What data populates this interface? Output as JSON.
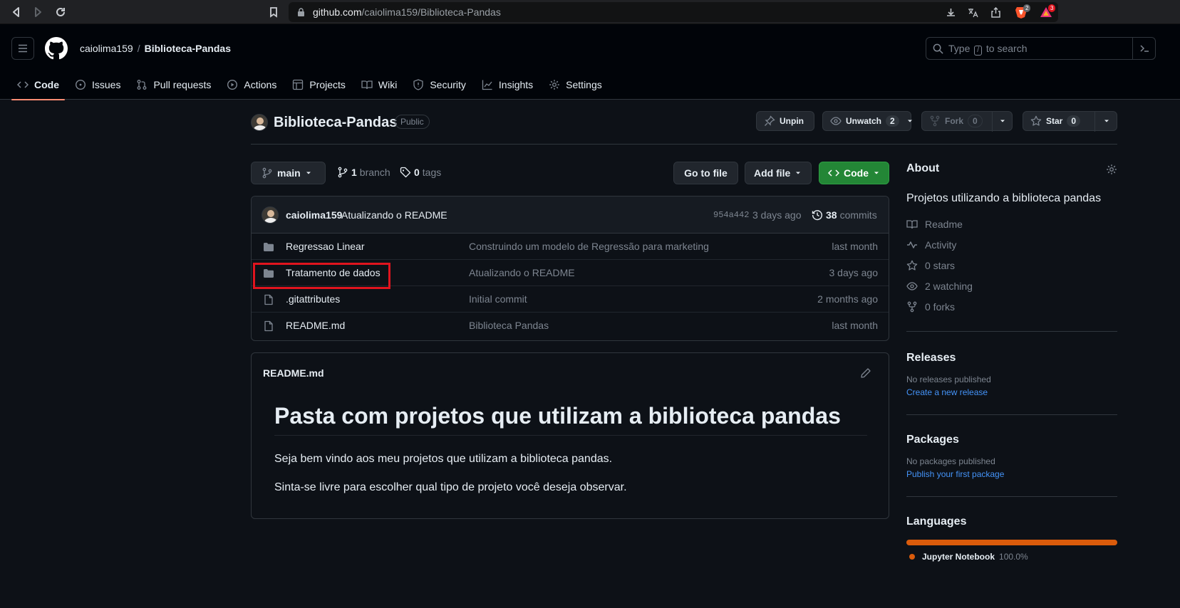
{
  "browser": {
    "url_host": "github.com",
    "url_path": "/caiolima159/Biblioteca-Pandas",
    "brave_badge": "2",
    "ext_badge": "3"
  },
  "header": {
    "owner": "caiolima159",
    "separator": "/",
    "repo": "Biblioteca-Pandas",
    "search_prefix": "Type",
    "search_key": "/",
    "search_suffix": "to search"
  },
  "tabs": [
    {
      "label": "Code",
      "icon": "code-icon"
    },
    {
      "label": "Issues",
      "icon": "issue-icon"
    },
    {
      "label": "Pull requests",
      "icon": "pull-request-icon"
    },
    {
      "label": "Actions",
      "icon": "play-icon"
    },
    {
      "label": "Projects",
      "icon": "table-icon"
    },
    {
      "label": "Wiki",
      "icon": "book-icon"
    },
    {
      "label": "Security",
      "icon": "shield-icon"
    },
    {
      "label": "Insights",
      "icon": "graph-icon"
    },
    {
      "label": "Settings",
      "icon": "gear-icon"
    }
  ],
  "repo": {
    "title": "Biblioteca-Pandas",
    "visibility": "Public",
    "unpin": "Unpin",
    "watch": "Unwatch",
    "watch_count": "2",
    "fork": "Fork",
    "fork_count": "0",
    "star": "Star",
    "star_count": "0"
  },
  "branchbar": {
    "branch": "main",
    "branch_count": "1",
    "branch_label": "branch",
    "tag_count": "0",
    "tag_label": "tags",
    "goto": "Go to file",
    "addfile": "Add file",
    "code": "Code"
  },
  "commit": {
    "author": "caiolima159",
    "message": "Atualizando o README",
    "sha": "954a442",
    "time": "3 days ago",
    "count": "38",
    "count_label": "commits"
  },
  "files": [
    {
      "type": "folder",
      "name": "Regressao Linear",
      "message": "Construindo um modelo de Regressão para marketing",
      "date": "last month"
    },
    {
      "type": "folder",
      "name": "Tratamento de dados",
      "message": "Atualizando o README",
      "date": "3 days ago"
    },
    {
      "type": "file",
      "name": ".gitattributes",
      "message": "Initial commit",
      "date": "2 months ago"
    },
    {
      "type": "file",
      "name": "README.md",
      "message": "Biblioteca Pandas",
      "date": "last month"
    }
  ],
  "readme": {
    "filename": "README.md",
    "heading": "Pasta com projetos que utilizam a biblioteca pandas",
    "p1": "Seja bem vindo aos meu projetos que utilizam a biblioteca pandas.",
    "p2": "Sinta-se livre para escolher qual tipo de projeto você deseja observar."
  },
  "about": {
    "title": "About",
    "description": "Projetos utilizando a biblioteca pandas",
    "readme": "Readme",
    "activity": "Activity",
    "stars": "0 stars",
    "watching": "2 watching",
    "forks": "0 forks"
  },
  "releases": {
    "title": "Releases",
    "none": "No releases published",
    "link": "Create a new release"
  },
  "packages": {
    "title": "Packages",
    "none": "No packages published",
    "link": "Publish your first package"
  },
  "languages": {
    "title": "Languages",
    "name": "Jupyter Notebook",
    "percent": "100.0%",
    "share": 100,
    "color": "#DA5B0B"
  },
  "colors": {
    "accent": "#fd8c73",
    "green": "#238636",
    "link": "#4493f8",
    "highlight": "#e0141e"
  }
}
